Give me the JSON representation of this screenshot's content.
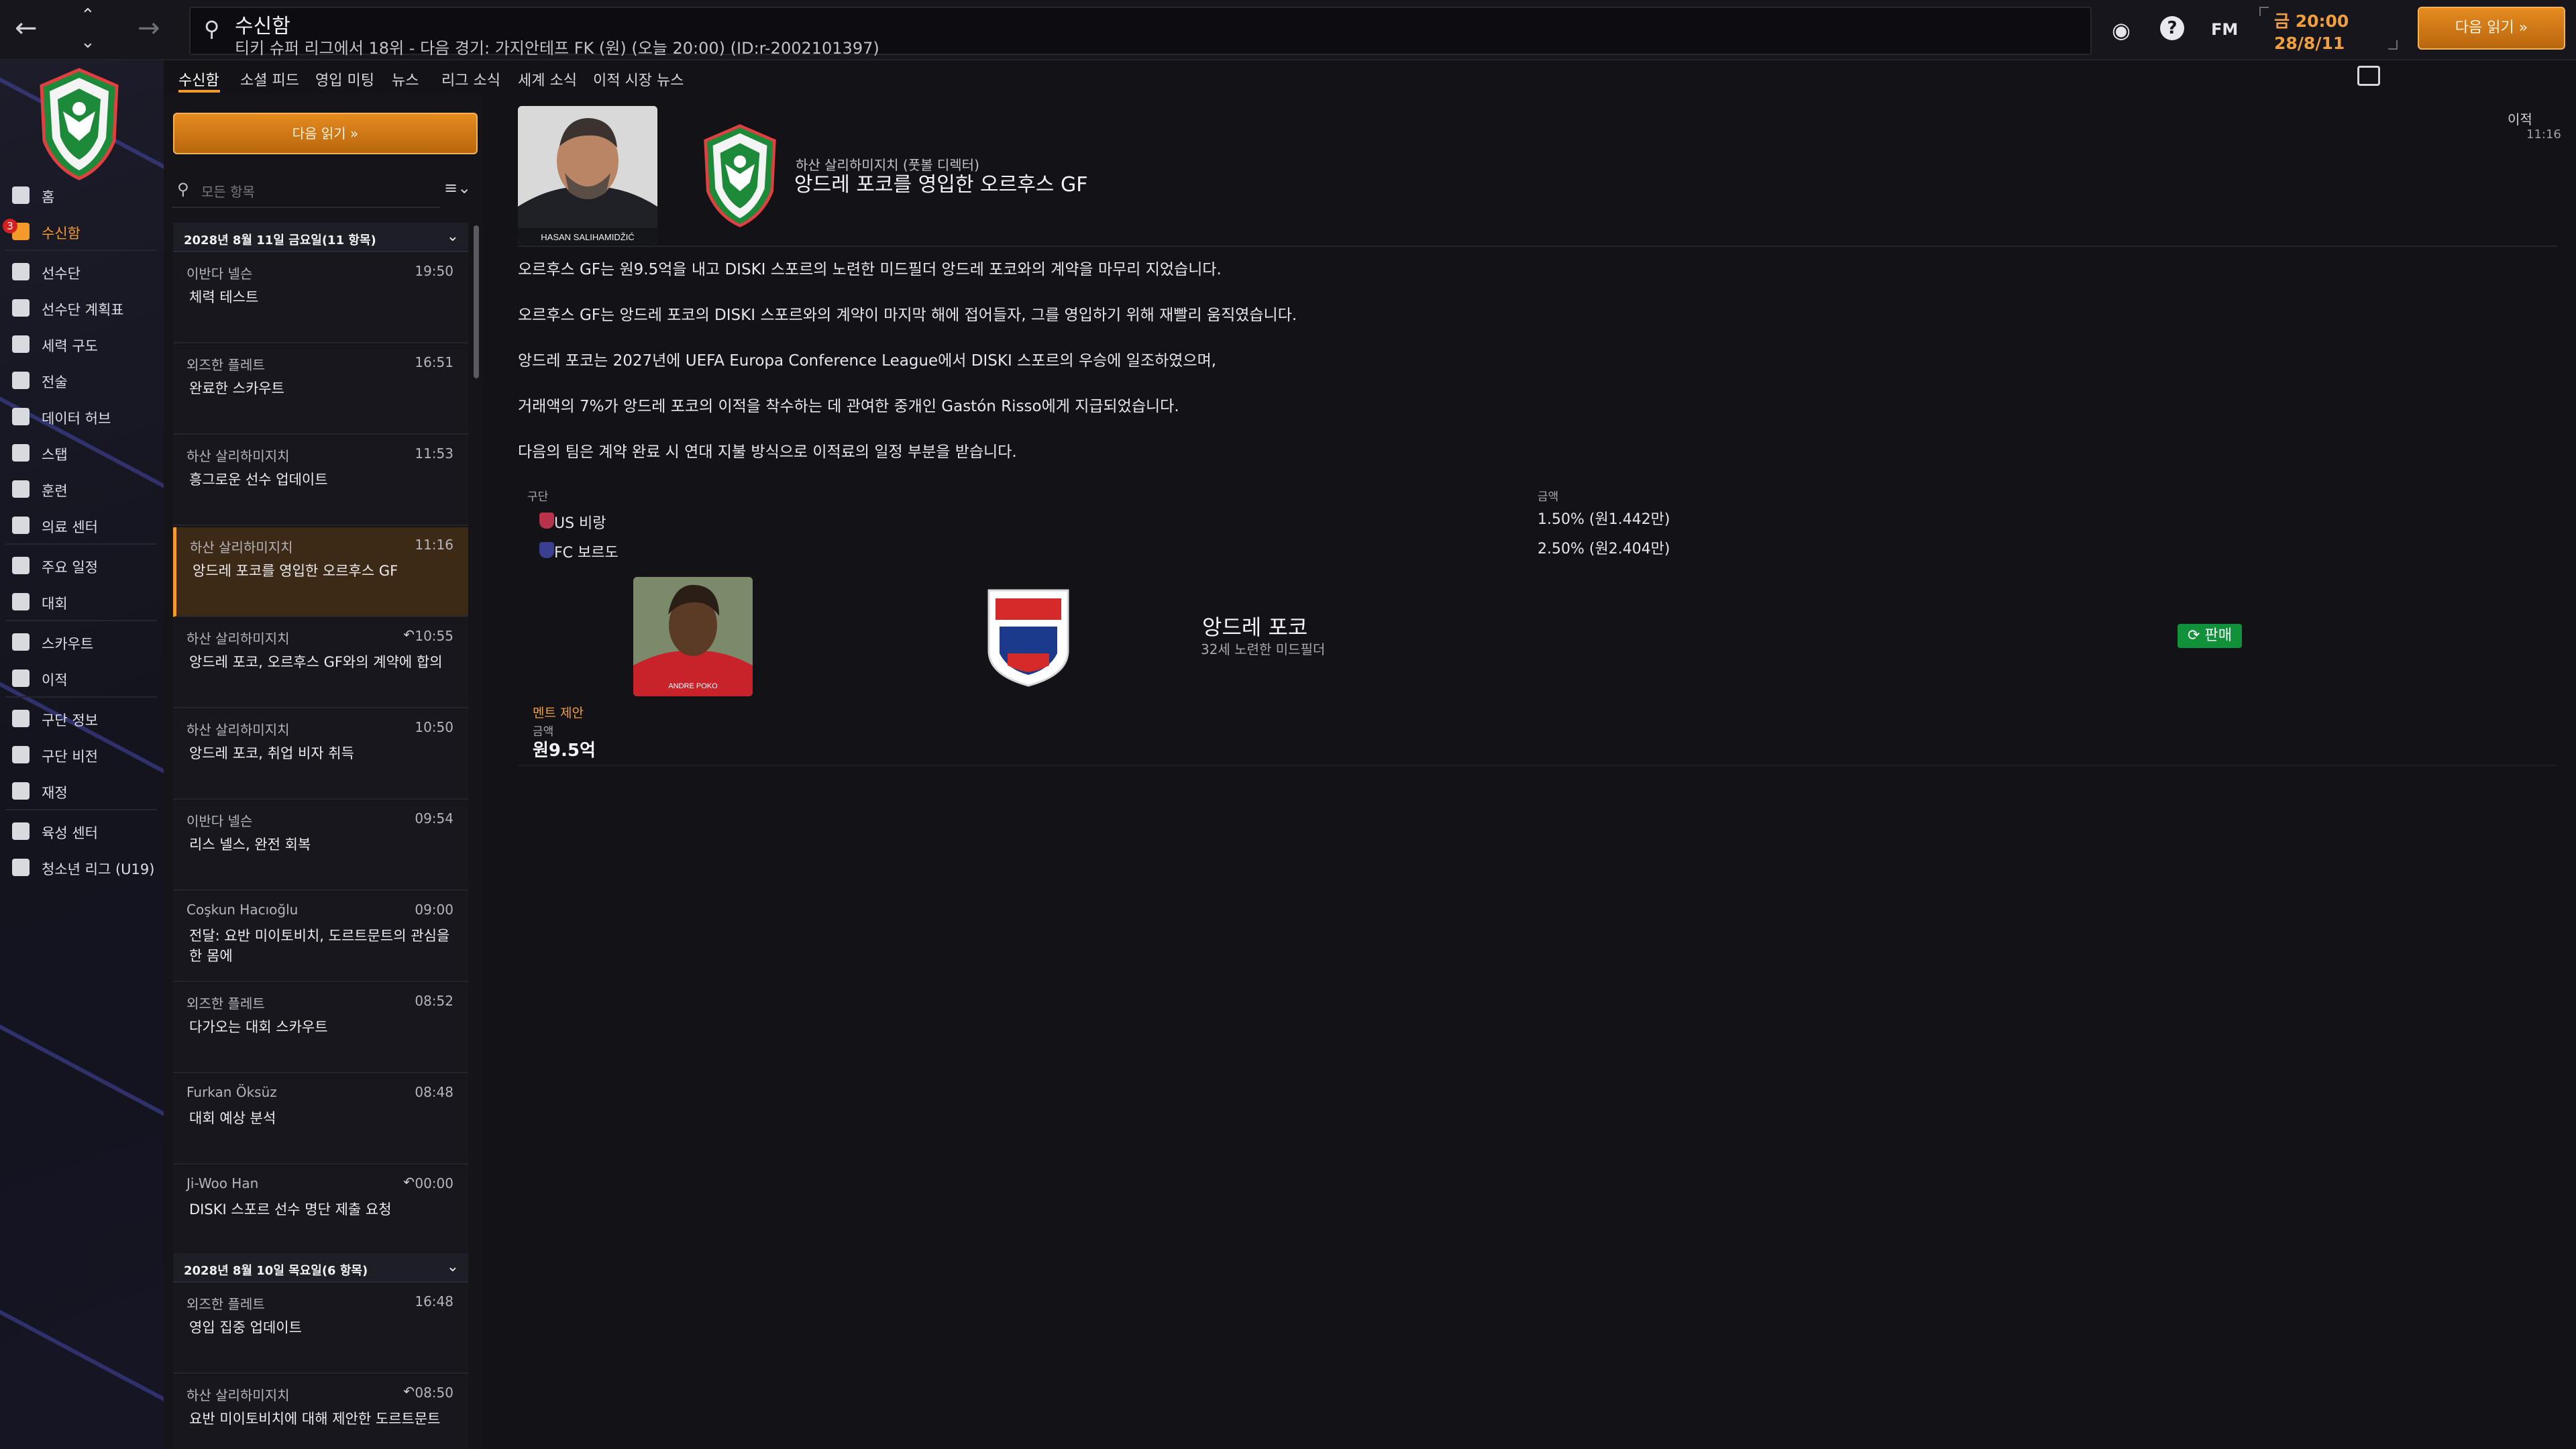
{
  "topbar": {
    "title": "수신함",
    "subtitle": "티키 슈퍼 리그에서 18위 - 다음 경기: 가지안테프 FK (원) (오늘 20:00) (ID:r-2002101397)",
    "fm_label": "FM",
    "clock_time": "금 20:00",
    "clock_date": "28/8/11",
    "continue_label": "다음 읽기 »"
  },
  "sidebar": {
    "badge": "3",
    "items": [
      {
        "label": "홈",
        "icon": "home-icon"
      },
      {
        "label": "수신함",
        "icon": "inbox-icon"
      },
      {
        "label": "선수단",
        "icon": "shirt-icon"
      },
      {
        "label": "선수단 계획표",
        "icon": "clipboard-icon"
      },
      {
        "label": "세력 구도",
        "icon": "hierarchy-icon"
      },
      {
        "label": "전술",
        "icon": "tactics-icon"
      },
      {
        "label": "데이터 허브",
        "icon": "data-hub-icon"
      },
      {
        "label": "스탭",
        "icon": "staff-icon"
      },
      {
        "label": "훈련",
        "icon": "training-icon"
      },
      {
        "label": "의료 센터",
        "icon": "medical-icon"
      },
      {
        "label": "주요 일정",
        "icon": "calendar-icon"
      },
      {
        "label": "대회",
        "icon": "trophy-icon"
      },
      {
        "label": "스카우트",
        "icon": "scout-icon"
      },
      {
        "label": "이적",
        "icon": "transfer-icon"
      },
      {
        "label": "구단 정보",
        "icon": "club-shield-icon"
      },
      {
        "label": "구단 비전",
        "icon": "vision-icon"
      },
      {
        "label": "재정",
        "icon": "finance-icon"
      },
      {
        "label": "육성 센터",
        "icon": "development-icon"
      },
      {
        "label": "청소년 리그 (U19)",
        "icon": "youth-icon"
      }
    ]
  },
  "tabs": [
    "수신함",
    "소셜 피드",
    "영입 미팅",
    "뉴스",
    "리그 소식",
    "세계 소식",
    "이적 시장 뉴스"
  ],
  "list": {
    "read_next": "다음 읽기 »",
    "filter_placeholder": "모든 항목",
    "groups": [
      {
        "header": "2028년 8월 11일 금요일(11 항목)",
        "messages": [
          {
            "sender": "이반다 넬슨",
            "time": "19:50",
            "subject": "체력 테스트",
            "reply": ""
          },
          {
            "sender": "외즈한 플레트",
            "time": "16:51",
            "subject": "완료한 스카우트",
            "reply": ""
          },
          {
            "sender": "하산 살리하미지치",
            "time": "11:53",
            "subject": "흥그로운 선수 업데이트",
            "reply": ""
          },
          {
            "sender": "하산 살리하미지치",
            "time": "11:16",
            "subject": "앙드레 포코를 영입한 오르후스 GF",
            "reply": ""
          },
          {
            "sender": "하산 살리하미지치",
            "time": "10:55",
            "subject": "앙드레 포코, 오르후스 GF와의 계약에 합의",
            "reply": "↶"
          },
          {
            "sender": "하산 살리하미지치",
            "time": "10:50",
            "subject": "앙드레 포코, 취업 비자 취득",
            "reply": ""
          },
          {
            "sender": "이반다 넬슨",
            "time": "09:54",
            "subject": "리스 넬스, 완전 회복",
            "reply": ""
          },
          {
            "sender": "Coşkun Hacıoğlu",
            "time": "09:00",
            "subject": "전달: 요반 미이토비치, 도르트문트의 관심을 한 몸에",
            "reply": ""
          },
          {
            "sender": "외즈한 플레트",
            "time": "08:52",
            "subject": "다가오는 대회 스카우트",
            "reply": ""
          },
          {
            "sender": "Furkan Öksüz",
            "time": "08:48",
            "subject": "대회 예상 분석",
            "reply": ""
          },
          {
            "sender": "Ji-Woo Han",
            "time": "00:00",
            "subject": "DISKI 스포르 선수 명단 제출 요청",
            "reply": "↶"
          }
        ]
      },
      {
        "header": "2028년 8월 10일 목요일(6 항목)",
        "messages": [
          {
            "sender": "외즈한 플레트",
            "time": "16:48",
            "subject": "영입 집중 업데이트",
            "reply": ""
          },
          {
            "sender": "하산 살리하미지치",
            "time": "08:50",
            "subject": "요반 미이토비치에 대해 제안한 도르트문트",
            "reply": "↶"
          }
        ]
      }
    ]
  },
  "detail": {
    "photo_caption": "HASAN SALIHAMIDŽIĆ",
    "from": "하산 살리하미지치 (풋볼 디렉터)",
    "subject": "앙드레 포코를 영입한 오르후스 GF",
    "type_label": "이적",
    "type_time": "11:16",
    "paragraphs": [
      "오르후스 GF는 원9.5억을 내고 DISKI 스포르의 노련한 미드필더 앙드레 포코와의 계약을 마무리 지었습니다.",
      "오르후스 GF는 앙드레 포코의 DISKI 스포르와의 계약이 마지막 해에 접어들자, 그를 영입하기 위해 재빨리 움직였습니다.",
      "앙드레 포코는 2027년에 UEFA Europa Conference League에서 DISKI 스포르의 우승에 일조하였으며,",
      "거래액의 7%가 앙드레 포코의 이적을 착수하는 데 관여한 중개인 Gastón Risso에게 지급되었습니다.",
      "다음의 팀은 계약 완료 시 연대 지불 방식으로 이적료의 일정 부분을 받습니다."
    ],
    "table": {
      "col_club": "구단",
      "col_amount": "금액",
      "rows": [
        {
          "club": "US 비랑",
          "amount": "1.50% (원1.442만)",
          "color": "#b8334a"
        },
        {
          "club": "FC 보르도",
          "amount": "2.50% (원2.404만)",
          "color": "#3a3f8f"
        }
      ]
    },
    "player": {
      "name": "앙드레 포코",
      "desc": "32세 노련한 미드필더",
      "photo_caption": "ANDRE POKO",
      "sell_label": "판매"
    },
    "offer_label": "멘트 제안",
    "fee_label": "금액",
    "fee_value": "원9.5억"
  },
  "colors": {
    "accent": "#f39a2a",
    "button": "#d67c18",
    "sell": "#12913b",
    "background": "#121217",
    "panel": "#141419"
  }
}
